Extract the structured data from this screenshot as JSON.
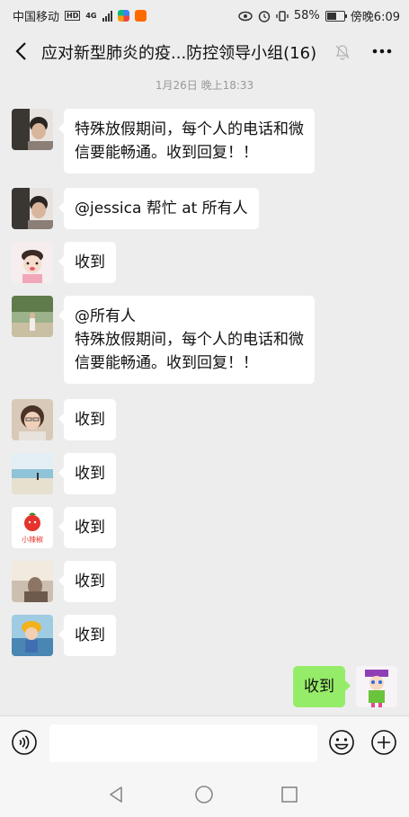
{
  "status_bar": {
    "carrier": "中国移动",
    "network_badge": "HD",
    "network_type": "4G",
    "battery_percent": "58%",
    "time": "傍晚6:09",
    "battery_level": 0.58
  },
  "header": {
    "title": "应对新型肺炎的疫...防控领导小组(16)",
    "muted": true
  },
  "timestamp": "1月26日 晚上18:33",
  "messages": [
    {
      "lines": [
        "特殊放假期间，每个人的电话和微",
        "信要能畅通。收到回复！！"
      ]
    },
    {
      "lines": [
        "@jessica  帮忙 at 所有人"
      ]
    },
    {
      "lines": [
        "收到"
      ]
    },
    {
      "lines": [
        "@所有人",
        "特殊放假期间，每个人的电话和微",
        "信要能畅通。收到回复！！"
      ]
    },
    {
      "lines": [
        "收到"
      ]
    },
    {
      "lines": [
        "收到"
      ]
    },
    {
      "lines": [
        "收到"
      ],
      "avatar_text": "小辣椒"
    },
    {
      "lines": [
        "收到"
      ]
    },
    {
      "lines": [
        "收到"
      ]
    }
  ],
  "self_message": {
    "text": "收到"
  },
  "input": {
    "value": "",
    "placeholder": ""
  },
  "colors": {
    "background": "#ededed",
    "self_bubble": "#95ec69",
    "other_bubble": "#ffffff",
    "timestamp": "#999999"
  },
  "icons": [
    "back-arrow-icon",
    "mute-bell-icon",
    "more-icon",
    "voice-icon",
    "emoji-icon",
    "plus-icon",
    "nav-back-icon",
    "nav-home-icon",
    "nav-recent-icon"
  ]
}
